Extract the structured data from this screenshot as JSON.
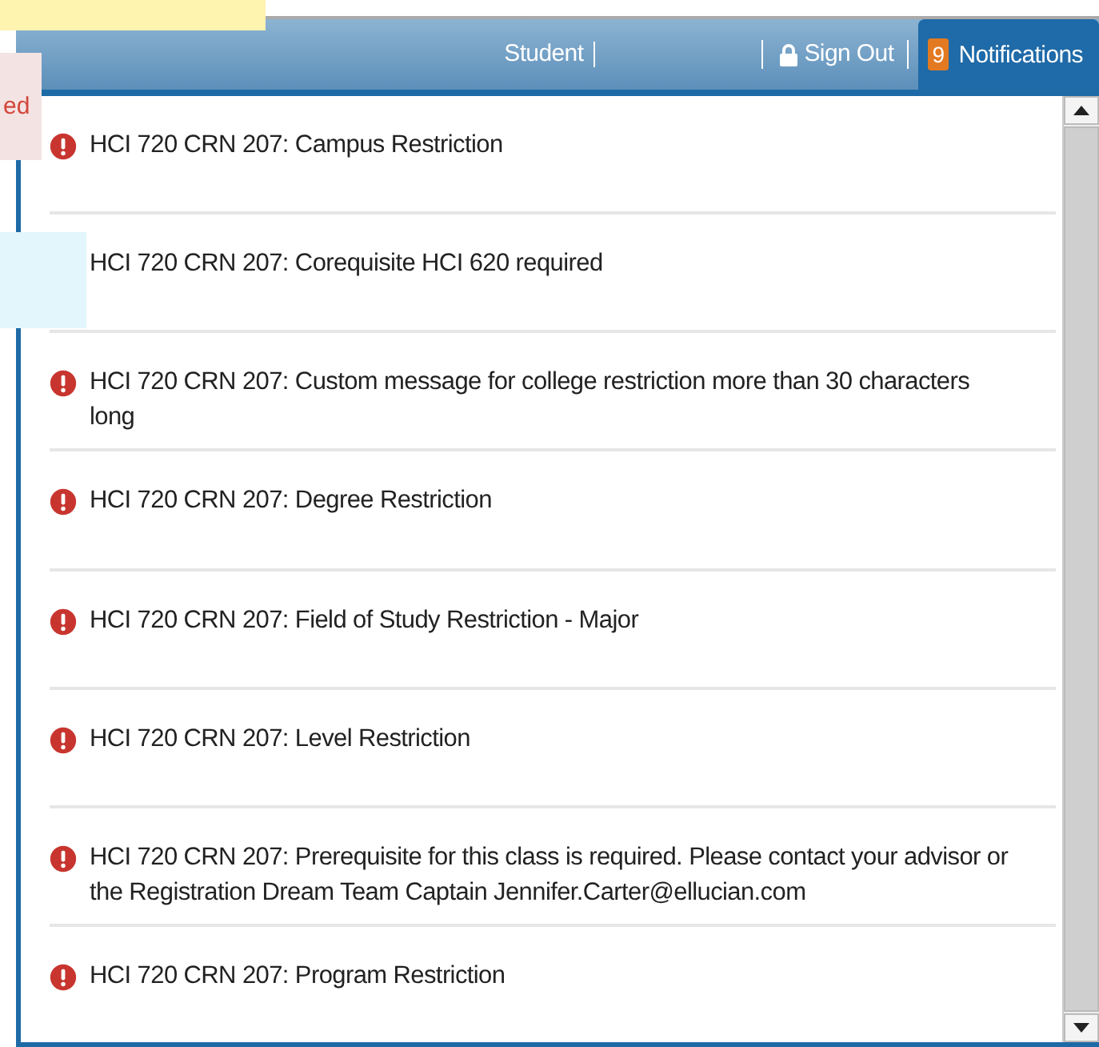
{
  "header": {
    "user_label": "Student",
    "sign_out": "Sign Out",
    "notifications": {
      "label": "Notifications",
      "count": "9"
    }
  },
  "overlays": {
    "note_text": "ed"
  },
  "notifications": [
    {
      "text": "HCI 720 CRN 207: Campus Restriction"
    },
    {
      "text": "HCI 720 CRN 207: Corequisite HCI 620 required"
    },
    {
      "text": "HCI 720 CRN 207: Custom message for college restriction more than 30 characters long"
    },
    {
      "text": "HCI 720 CRN 207: Degree Restriction"
    },
    {
      "text": "HCI 720 CRN 207: Field of Study Restriction - Major"
    },
    {
      "text": "HCI 720 CRN 207: Level Restriction"
    },
    {
      "text": "HCI 720 CRN 207: Prerequisite for this class is required. Please contact your advisor or the Registration Dream Team Captain Jennifer.Carter@ellucian.com"
    },
    {
      "text": "HCI 720 CRN 207: Program Restriction"
    }
  ]
}
